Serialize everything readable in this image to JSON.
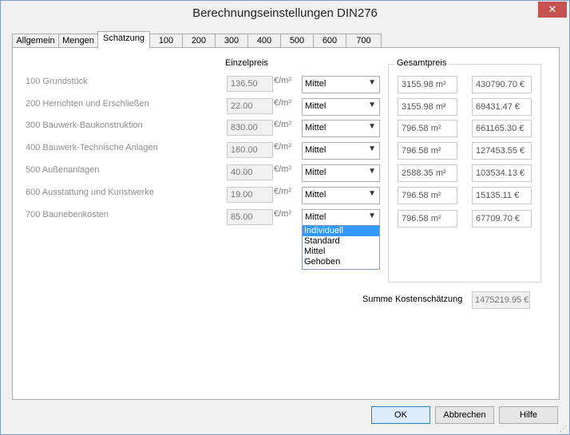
{
  "window": {
    "title": "Berechnungseinstellungen DIN276",
    "close_label": "✕"
  },
  "tabs": [
    {
      "label": "Allgemein"
    },
    {
      "label": "Mengen"
    },
    {
      "label": "Schätzung"
    },
    {
      "label": "100"
    },
    {
      "label": "200"
    },
    {
      "label": "300"
    },
    {
      "label": "400"
    },
    {
      "label": "500"
    },
    {
      "label": "600"
    },
    {
      "label": "700"
    }
  ],
  "active_tab": "Schätzung",
  "headers": {
    "einzelpreis": "Einzelpreis",
    "gesamtpreis": "Gesamtpreis"
  },
  "rows": [
    {
      "label": "100 Grundstück",
      "price": "136.50",
      "unit": "€/m²",
      "level": "Mittel",
      "area": "3155.98 m²",
      "total": "430790.70 €"
    },
    {
      "label": "200 Herrichten und Erschließen",
      "price": "22.00",
      "unit": "€/m²",
      "level": "Mittel",
      "area": "3155.98 m²",
      "total": "69431.47 €"
    },
    {
      "label": "300 Bauwerk-Baukonstruktion",
      "price": "830.00",
      "unit": "€/m²",
      "level": "Mittel",
      "area": "796.58 m²",
      "total": "661165.30 €"
    },
    {
      "label": "400 Bauwerk-Technische Anlagen",
      "price": "160.00",
      "unit": "€/m²",
      "level": "Mittel",
      "area": "796.58 m²",
      "total": "127453.55 €"
    },
    {
      "label": "500 Außenanlagen",
      "price": "40.00",
      "unit": "€/m²",
      "level": "Mittel",
      "area": "2588.35 m²",
      "total": "103534.13 €"
    },
    {
      "label": "600 Ausstattung und Kunstwerke",
      "price": "19.00",
      "unit": "€/m²",
      "level": "Mittel",
      "area": "796.58 m²",
      "total": "15135.11 €"
    },
    {
      "label": "700 Baunebenkosten",
      "price": "85.00",
      "unit": "€/m²",
      "level": "Mittel",
      "area": "796.58 m²",
      "total": "67709.70 €"
    }
  ],
  "dropdown_options": [
    "Individuell",
    "Standard",
    "Mittel",
    "Gehoben"
  ],
  "dropdown_highlighted": "Individuell",
  "summary": {
    "label": "Summe Kostenschätzung",
    "value": "1475219.95 €"
  },
  "buttons": {
    "ok": "OK",
    "cancel": "Abbrechen",
    "help": "Hilfe"
  },
  "colors": {
    "selection": "#3399ff",
    "close": "#c75050",
    "default_button": "#dcecfc"
  }
}
